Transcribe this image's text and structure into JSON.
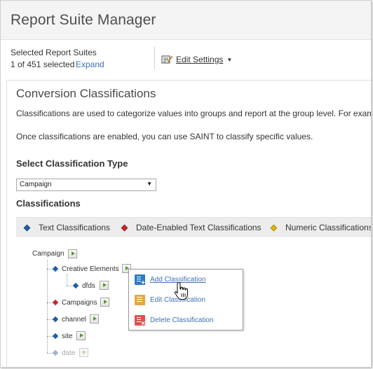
{
  "app": {
    "title": "Report Suite Manager"
  },
  "selection": {
    "label": "Selected Report Suites",
    "count_text": "1 of 451 selected",
    "expand_label": "Expand"
  },
  "toolbar": {
    "edit_settings_label": "Edit Settings"
  },
  "main": {
    "section_title": "Conversion Classifications",
    "description_line1": "Classifications are used to categorize values into groups and report at the group level. For examp",
    "description_line2": "Once classifications are enabled, you can use SAINT to classify specific values.",
    "select_type_heading": "Select Classification Type",
    "classification_type": {
      "selected": "Campaign"
    },
    "classifications_heading": "Classifications"
  },
  "legend": [
    {
      "label": "Text Classifications",
      "color": "#1f5ea8"
    },
    {
      "label": "Date-Enabled Text Classifications",
      "color": "#c62828"
    },
    {
      "label": "Numeric Classifications",
      "color": "#e0b800"
    }
  ],
  "tree": {
    "root": {
      "label": "Campaign"
    },
    "nodes": [
      {
        "label": "Creative Elements",
        "type": "text",
        "color": "#1f5ea8"
      },
      {
        "label": "dfds",
        "type": "text",
        "color": "#1f5ea8"
      },
      {
        "label": "Campaigns",
        "type": "date-enabled",
        "color": "#c62828"
      },
      {
        "label": "channel",
        "type": "text",
        "color": "#1f5ea8"
      },
      {
        "label": "site",
        "type": "text",
        "color": "#1f5ea8"
      },
      {
        "label": "date",
        "type": "text",
        "color": "#9fb4cf",
        "disabled": true
      }
    ]
  },
  "context_menu": {
    "items": [
      {
        "label": "Add Classification",
        "icon": "add-classification-icon"
      },
      {
        "label": "Edit Classification",
        "icon": "edit-classification-icon"
      },
      {
        "label": "Delete Classification",
        "icon": "delete-classification-icon"
      }
    ]
  },
  "icons": {
    "edit_settings": "edit-settings-icon",
    "dropdown": "chevron-down-icon",
    "tree_action": "play-arrow-icon",
    "cursor": "hand-pointer-icon"
  }
}
